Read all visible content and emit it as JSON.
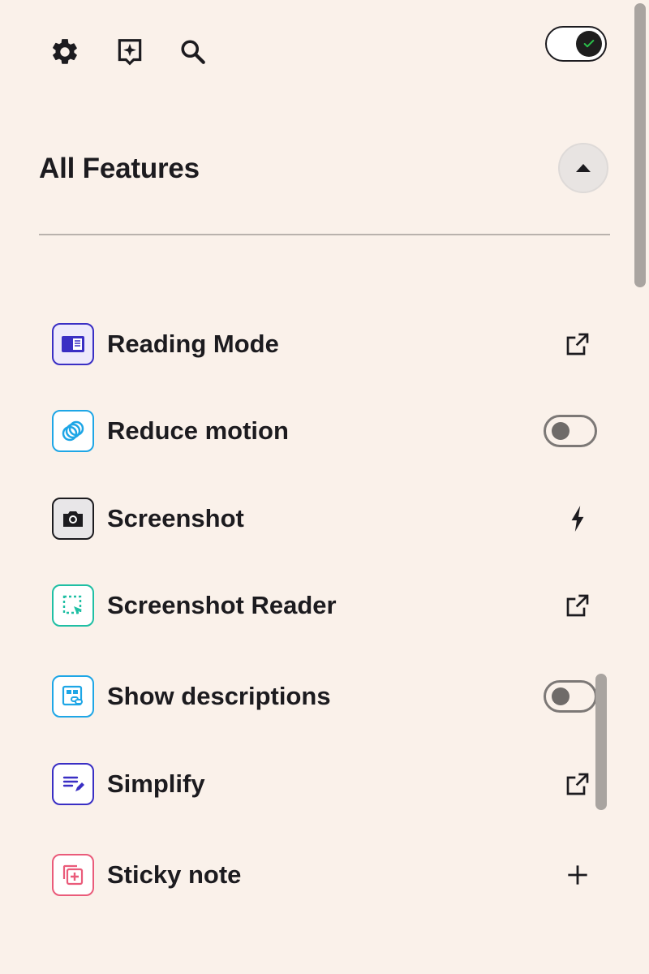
{
  "toolbar": {
    "settings_icon": "gear-icon",
    "ai_icon": "sparkle-chat-icon",
    "search_icon": "search-icon",
    "master_toggle_state": "on"
  },
  "section": {
    "title": "All Features",
    "collapse_icon": "caret-up-icon"
  },
  "features": [
    {
      "label": "Reading Mode",
      "icon": "reading-mode-icon",
      "color": "#3a2fc4",
      "action": "open-external-icon"
    },
    {
      "label": "Reduce motion",
      "icon": "reduce-motion-icon",
      "color": "#1ea6e6",
      "action": "toggle",
      "state": "off"
    },
    {
      "label": "Screenshot",
      "icon": "camera-icon",
      "color": "#1c1b1f",
      "action": "lightning-icon"
    },
    {
      "label": "Screenshot Reader",
      "icon": "screenshot-reader-icon",
      "color": "#1fbfa4",
      "action": "open-external-icon"
    },
    {
      "label": "Show descriptions",
      "icon": "image-link-icon",
      "color": "#1ea6e6",
      "action": "toggle",
      "state": "off"
    },
    {
      "label": "Simplify",
      "icon": "simplify-icon",
      "color": "#3a2fc4",
      "action": "open-external-icon"
    },
    {
      "label": "Sticky note",
      "icon": "sticky-note-icon",
      "color": "#ea5b7a",
      "action": "plus-icon"
    }
  ],
  "colors": {
    "background": "#faf1ea",
    "text": "#1c1b1f",
    "divider": "#b9b2ad"
  }
}
